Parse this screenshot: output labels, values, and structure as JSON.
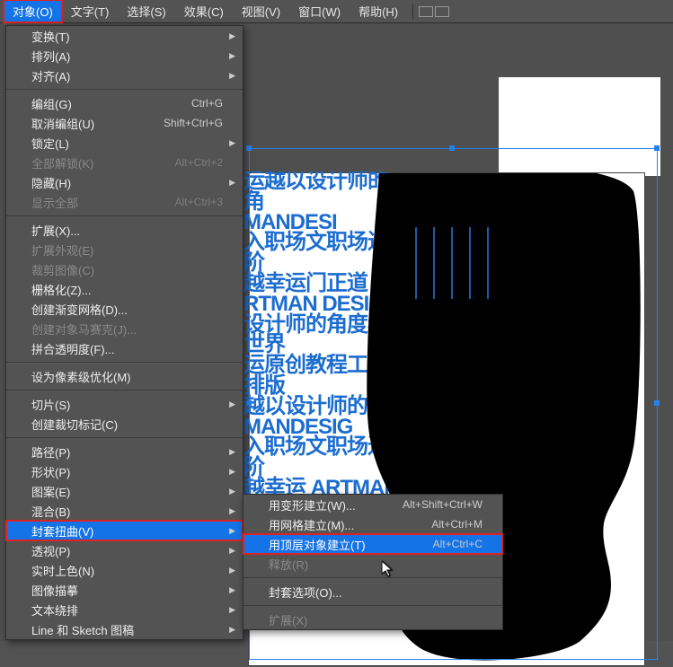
{
  "menubar": {
    "items": [
      "对象(O)",
      "文字(T)",
      "选择(S)",
      "效果(C)",
      "视图(V)",
      "窗口(W)",
      "帮助(H)"
    ],
    "active_index": 0
  },
  "dropdown": {
    "groups": [
      [
        {
          "label": "变换(T)",
          "sub": true
        },
        {
          "label": "排列(A)",
          "sub": true
        },
        {
          "label": "对齐(A)",
          "sub": true
        }
      ],
      [
        {
          "label": "编组(G)",
          "shortcut": "Ctrl+G"
        },
        {
          "label": "取消编组(U)",
          "shortcut": "Shift+Ctrl+G"
        },
        {
          "label": "锁定(L)",
          "sub": true
        },
        {
          "label": "全部解锁(K)",
          "shortcut": "Alt+Ctrl+2",
          "disabled": true
        },
        {
          "label": "隐藏(H)",
          "sub": true
        },
        {
          "label": "显示全部",
          "shortcut": "Alt+Ctrl+3",
          "disabled": true
        }
      ],
      [
        {
          "label": "扩展(X)..."
        },
        {
          "label": "扩展外观(E)",
          "disabled": true
        },
        {
          "label": "裁剪图像(C)",
          "disabled": true
        },
        {
          "label": "栅格化(Z)..."
        },
        {
          "label": "创建渐变网格(D)..."
        },
        {
          "label": "创建对象马赛克(J)...",
          "disabled": true
        },
        {
          "label": "拼合透明度(F)..."
        }
      ],
      [
        {
          "label": "设为像素级优化(M)"
        }
      ],
      [
        {
          "label": "切片(S)",
          "sub": true
        },
        {
          "label": "创建裁切标记(C)"
        }
      ],
      [
        {
          "label": "路径(P)",
          "sub": true
        },
        {
          "label": "形状(P)",
          "sub": true
        },
        {
          "label": "图案(E)",
          "sub": true
        },
        {
          "label": "混合(B)",
          "sub": true
        },
        {
          "label": "封套扭曲(V)",
          "sub": true,
          "hover": true,
          "boxed": true
        },
        {
          "label": "透视(P)",
          "sub": true
        },
        {
          "label": "实时上色(N)",
          "sub": true
        },
        {
          "label": "图像描摹",
          "sub": true
        },
        {
          "label": "文本绕排",
          "sub": true
        },
        {
          "label": "Line 和 Sketch 图稿",
          "sub": true
        }
      ]
    ]
  },
  "submenu": {
    "groups": [
      [
        {
          "label": "用变形建立(W)...",
          "shortcut": "Alt+Shift+Ctrl+W"
        },
        {
          "label": "用网格建立(M)...",
          "shortcut": "Alt+Ctrl+M"
        },
        {
          "label": "用顶层对象建立(T)",
          "shortcut": "Alt+Ctrl+C",
          "hover": true,
          "boxed": true
        },
        {
          "label": "释放(R)",
          "disabled": true
        }
      ],
      [
        {
          "label": "封套选项(O)..."
        }
      ],
      [
        {
          "label": "扩展(X)",
          "disabled": true
        }
      ]
    ]
  },
  "canvas": {
    "text": "运越以设计师的角\nMANDESI\n入职场文职场进阶\n越幸运门正道 ARTMAN DESIGN\n设计师的角度看世界\n运原创教程工具排版\n越以设计师的角\nMANDESIG\n入职场文职场进阶\n越幸运 ARTMAN 庞"
  }
}
